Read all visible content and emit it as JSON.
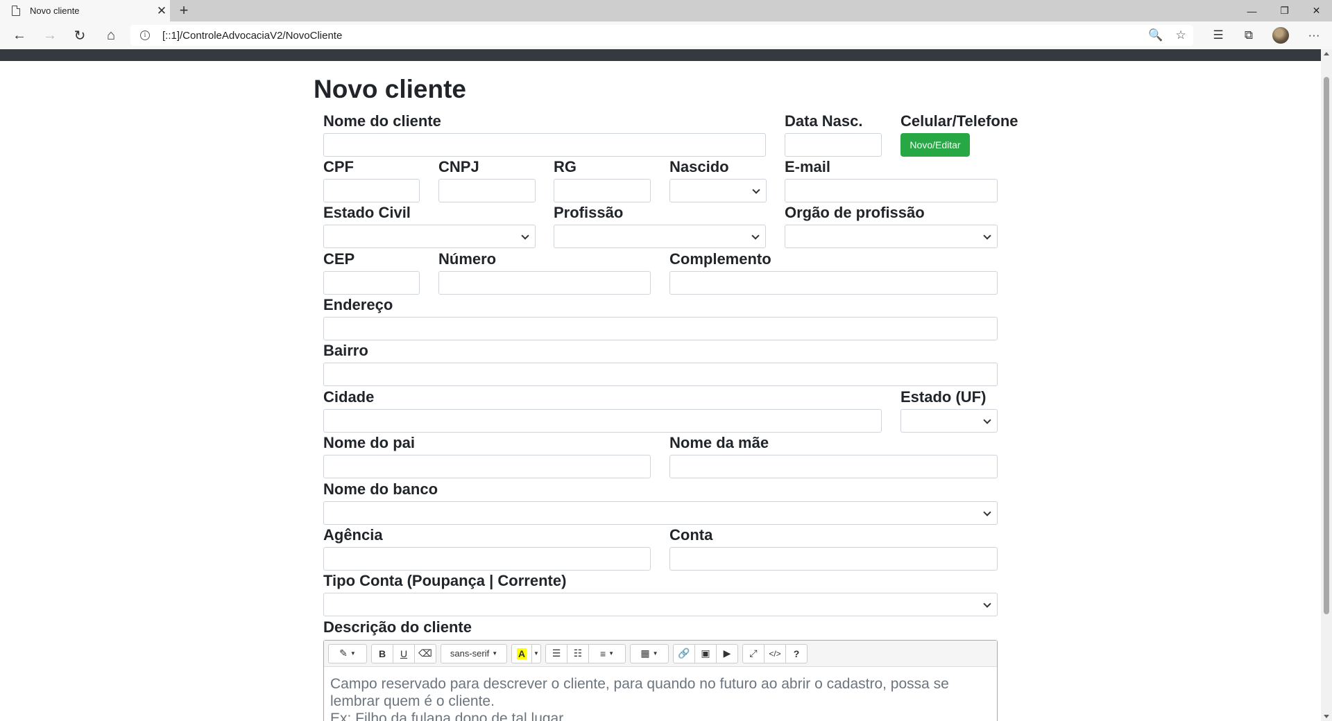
{
  "browser": {
    "tab_title": "Novo cliente",
    "tab_close": "✕",
    "new_tab": "+",
    "url": "[::1]/ControleAdvocaciaV2/NovoCliente",
    "minimize": "—",
    "restore": "❐",
    "close": "✕",
    "back": "←",
    "forward": "→",
    "refresh": "↻",
    "home": "⌂",
    "zoom": "🔍",
    "favorite": "☆",
    "favorites_list": "☰",
    "collections": "⧉",
    "more": "···"
  },
  "form": {
    "title": "Novo cliente",
    "labels": {
      "nome": "Nome do cliente",
      "data_nasc": "Data Nasc.",
      "celular": "Celular/Telefone",
      "cpf": "CPF",
      "cnpj": "CNPJ",
      "rg": "RG",
      "nascido": "Nascido",
      "email": "E-mail",
      "estado_civil": "Estado Civil",
      "profissao": "Profissão",
      "orgao": "Orgão de profissão",
      "cep": "CEP",
      "numero": "Número",
      "complemento": "Complemento",
      "endereco": "Endereço",
      "bairro": "Bairro",
      "cidade": "Cidade",
      "estado": "Estado (UF)",
      "pai": "Nome do pai",
      "mae": "Nome da mãe",
      "banco": "Nome do banco",
      "agencia": "Agência",
      "conta": "Conta",
      "tipo_conta": "Tipo Conta (Poupança | Corrente)",
      "descricao": "Descrição do cliente"
    },
    "novo_editar_button": "Novo/Editar"
  },
  "editor": {
    "toolbar": {
      "style": "✎",
      "bold": "B",
      "underline": "U",
      "clear": "⌫",
      "font": "sans-serif",
      "color": "A",
      "ul": "☰",
      "ol": "☷",
      "align": "≡",
      "table": "▦",
      "link": "🔗",
      "image": "▣",
      "video": "▶",
      "fullscreen": "⤢",
      "code": "</>",
      "help": "?"
    },
    "placeholder_line1": "Campo reservado para descrever o cliente, para quando no futuro ao abrir o cadastro, possa se",
    "placeholder_line2": "lembrar quem é o cliente.",
    "placeholder_line3": "Ex: Filho da fulana dono de tal lugar"
  }
}
